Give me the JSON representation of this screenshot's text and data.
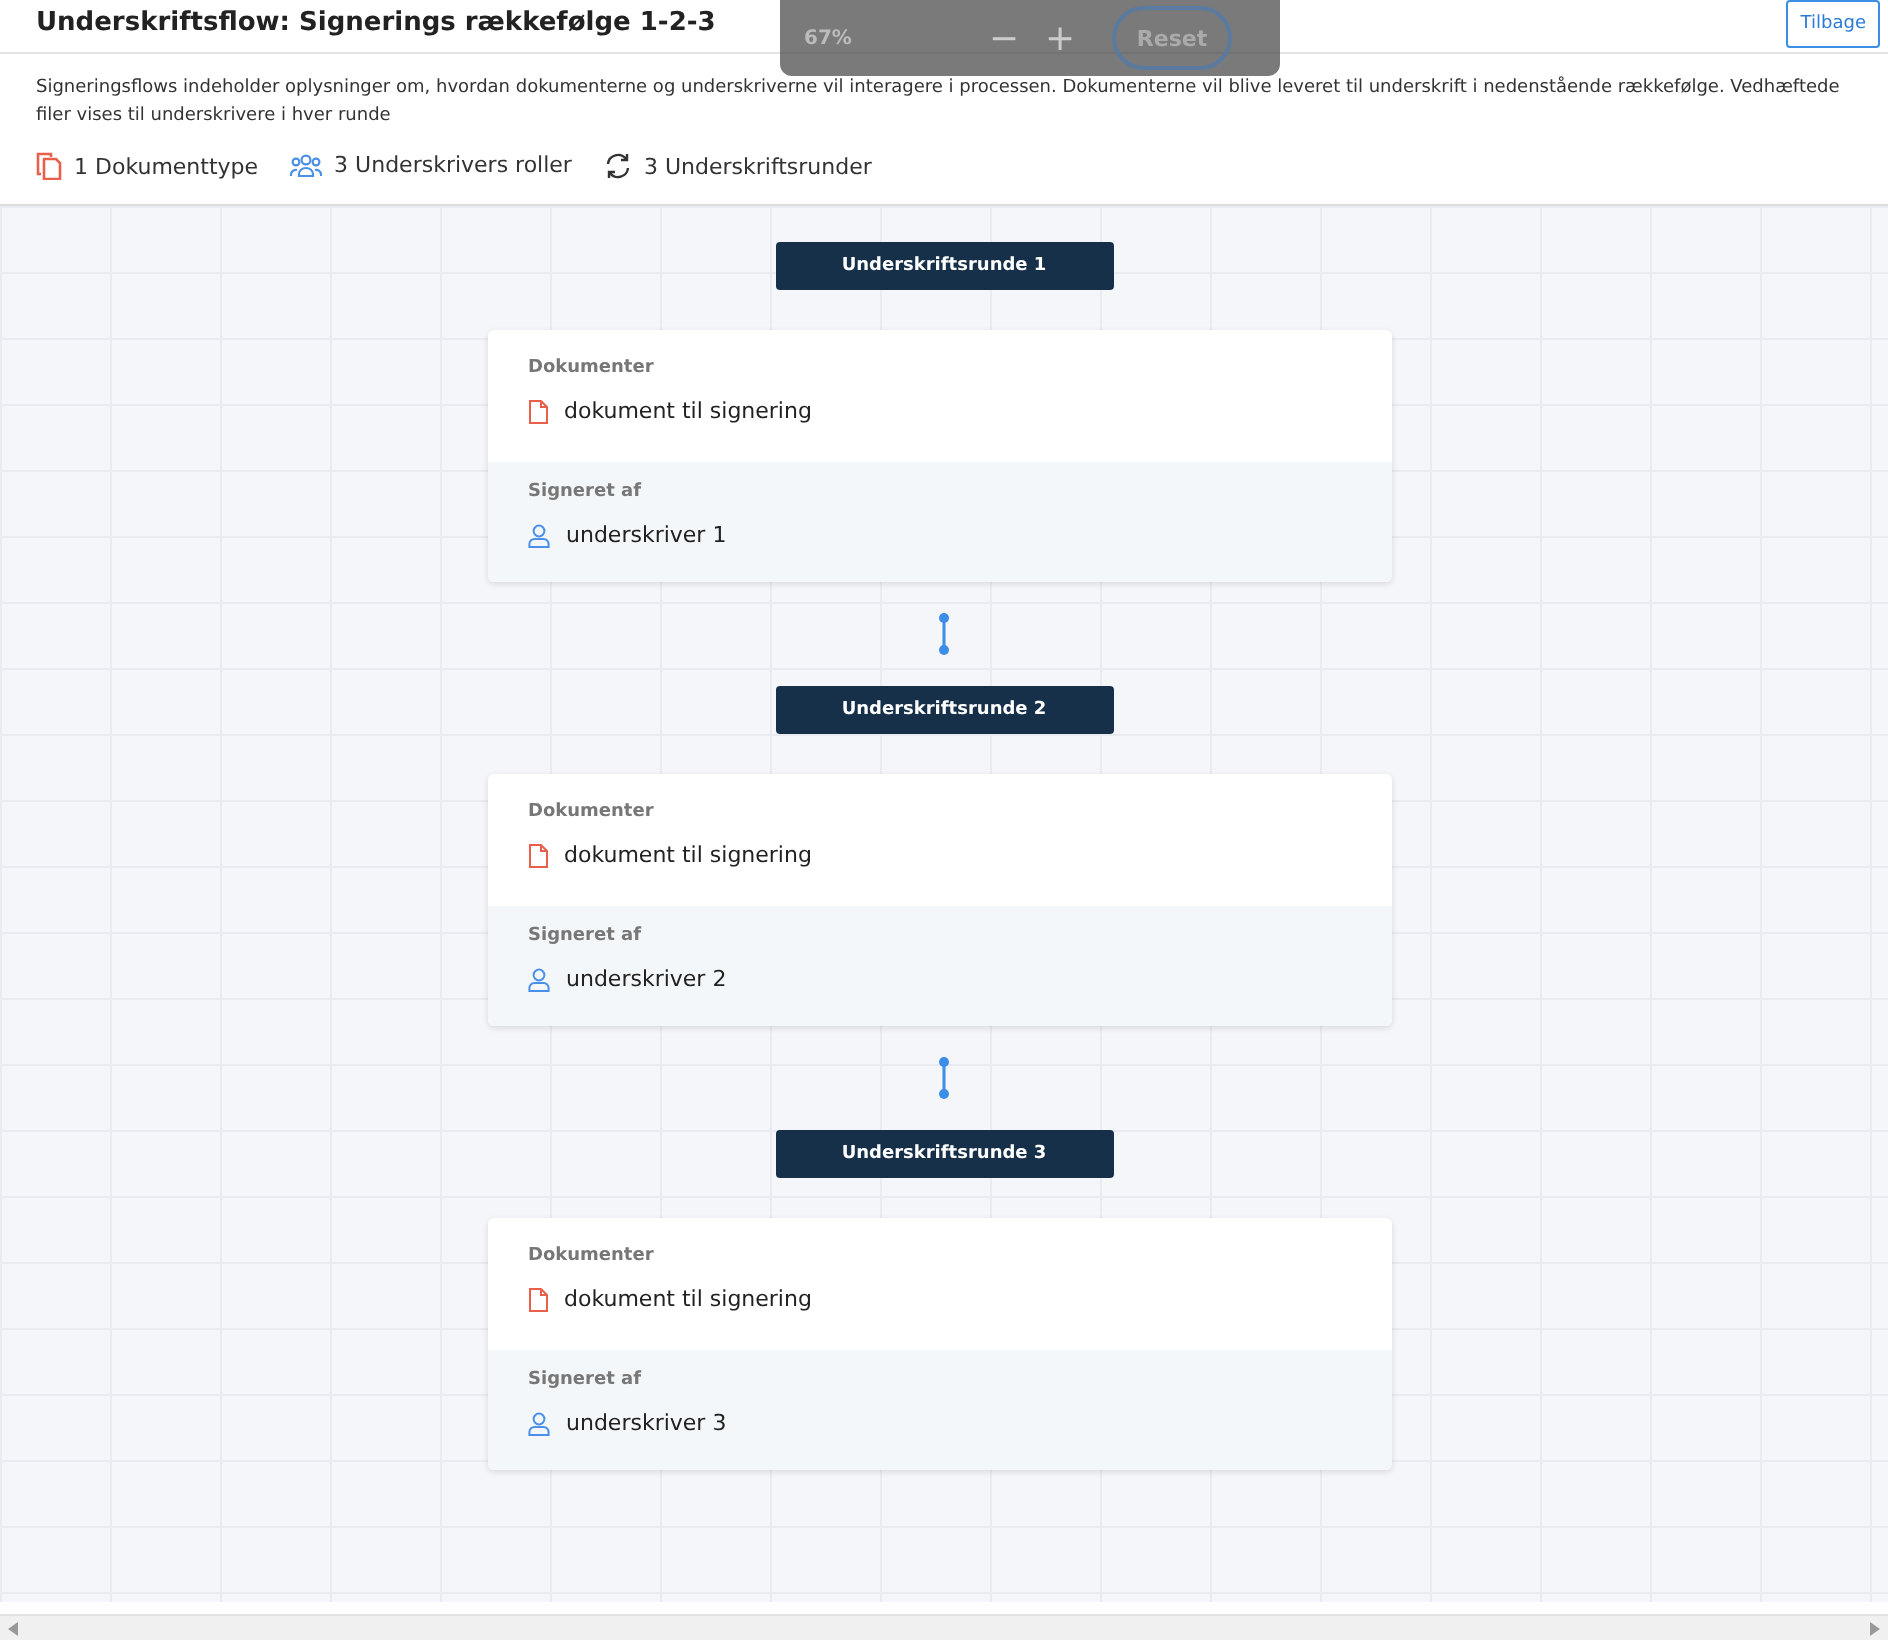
{
  "header": {
    "title": "Underskriftsflow: Signerings rækkefølge 1-2-3",
    "back_button": "Tilbage"
  },
  "zoom_overlay": {
    "level": "67%",
    "zoom_out": "−",
    "zoom_in": "+",
    "reset": "Reset"
  },
  "description": "Signeringsflows indeholder oplysninger om, hvordan dokumenterne og underskriverne vil interagere i processen. Dokumenterne vil blive leveret til underskrift i nedenstående rækkefølge. Vedhæftede filer vises til underskrivere i hver runde",
  "stats": [
    {
      "kind": "documents",
      "label": "1 Dokumenttype"
    },
    {
      "kind": "roles",
      "label": "3 Underskrivers roller"
    },
    {
      "kind": "rounds",
      "label": "3 Underskriftsrunder"
    }
  ],
  "rounds": [
    {
      "title": "Underskriftsrunde 1",
      "documents_label": "Dokumenter",
      "documents": [
        "dokument til signering"
      ],
      "signers_label": "Signeret af",
      "signers": [
        "underskriver 1"
      ]
    },
    {
      "title": "Underskriftsrunde 2",
      "documents_label": "Dokumenter",
      "documents": [
        "dokument til signering"
      ],
      "signers_label": "Signeret af",
      "signers": [
        "underskriver 2"
      ]
    },
    {
      "title": "Underskriftsrunde 3",
      "documents_label": "Dokumenter",
      "documents": [
        "dokument til signering"
      ],
      "signers_label": "Signeret af",
      "signers": [
        "underskriver 3"
      ]
    }
  ]
}
